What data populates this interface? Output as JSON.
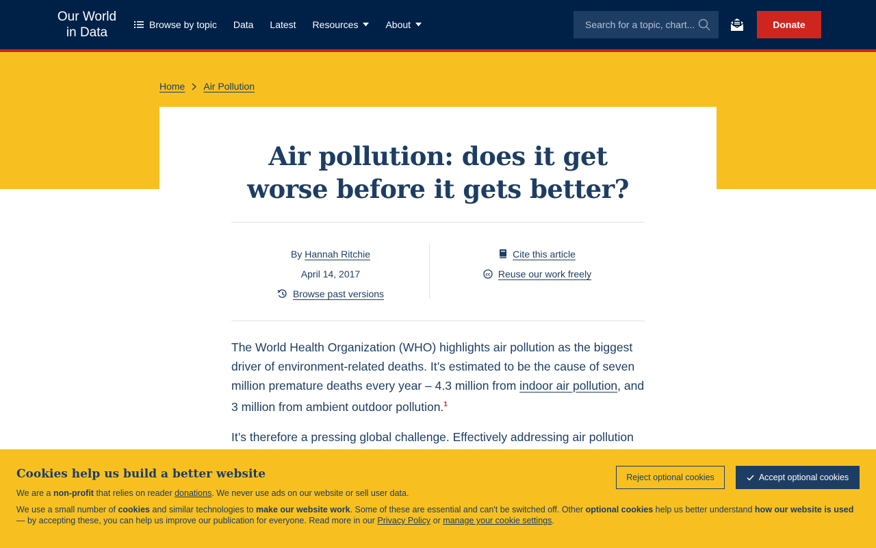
{
  "header": {
    "logo_line1": "Our World",
    "logo_line2": "in Data",
    "nav": {
      "browse": "Browse by topic",
      "data": "Data",
      "latest": "Latest",
      "resources": "Resources",
      "about": "About"
    },
    "search_placeholder": "Search for a topic, chart...",
    "donate": "Donate"
  },
  "breadcrumb": {
    "home": "Home",
    "current": "Air Pollution"
  },
  "article": {
    "title_line1": "Air pollution: does it get",
    "title_line2": "worse before it gets better?",
    "by_prefix": "By",
    "author": "Hannah Ritchie",
    "date": "April 14, 2017",
    "past_versions": "Browse past versions",
    "cite": "Cite this article",
    "reuse": "Reuse our work freely",
    "p1_a": "The World Health Organization (WHO) highlights air pollution as the biggest driver of environment-related deaths. It’s estimated to be the cause of seven million premature deaths every year – 4.3 million from ",
    "p1_link": "indoor air pollution",
    "p1_b": ", and 3 million from ambient outdoor pollution.",
    "p1_fn": "1",
    "p2": "It’s therefore a pressing global challenge. Effectively addressing air pollution"
  },
  "cookies": {
    "title": "Cookies help us build a better website",
    "p1_a": "We are a ",
    "p1_bold": "non-profit",
    "p1_b": " that relies on reader ",
    "p1_link": "donations",
    "p1_c": ". We never use ads on our website or sell user data.",
    "p2_a": "We use a small number of ",
    "p2_b1": "cookies",
    "p2_b": " and similar technologies to ",
    "p2_b2": "make our website work",
    "p2_c": ". Some of these are essential and can't be switched off. Other ",
    "p2_b3": "optional cookies",
    "p2_d": " help us better understand ",
    "p2_b4": "how our website is used",
    "p2_e": " — by accepting these, you can help us improve our publication for everyone. Read more in our ",
    "p2_link1": "Privacy Policy",
    "p2_f": " or ",
    "p2_link2": "manage your cookie settings",
    "p2_g": ".",
    "reject": "Reject optional cookies",
    "accept": "Accept optional cookies"
  },
  "colors": {
    "navy": "#002147",
    "accent_red": "#ce261e",
    "yellow": "#f7c020",
    "text": "#1d3d63"
  },
  "icons": [
    "list-icon",
    "chevron-down-icon",
    "search-icon",
    "mail-icon",
    "chevron-right-icon",
    "history-icon",
    "book-icon",
    "creative-commons-icon",
    "check-icon"
  ]
}
